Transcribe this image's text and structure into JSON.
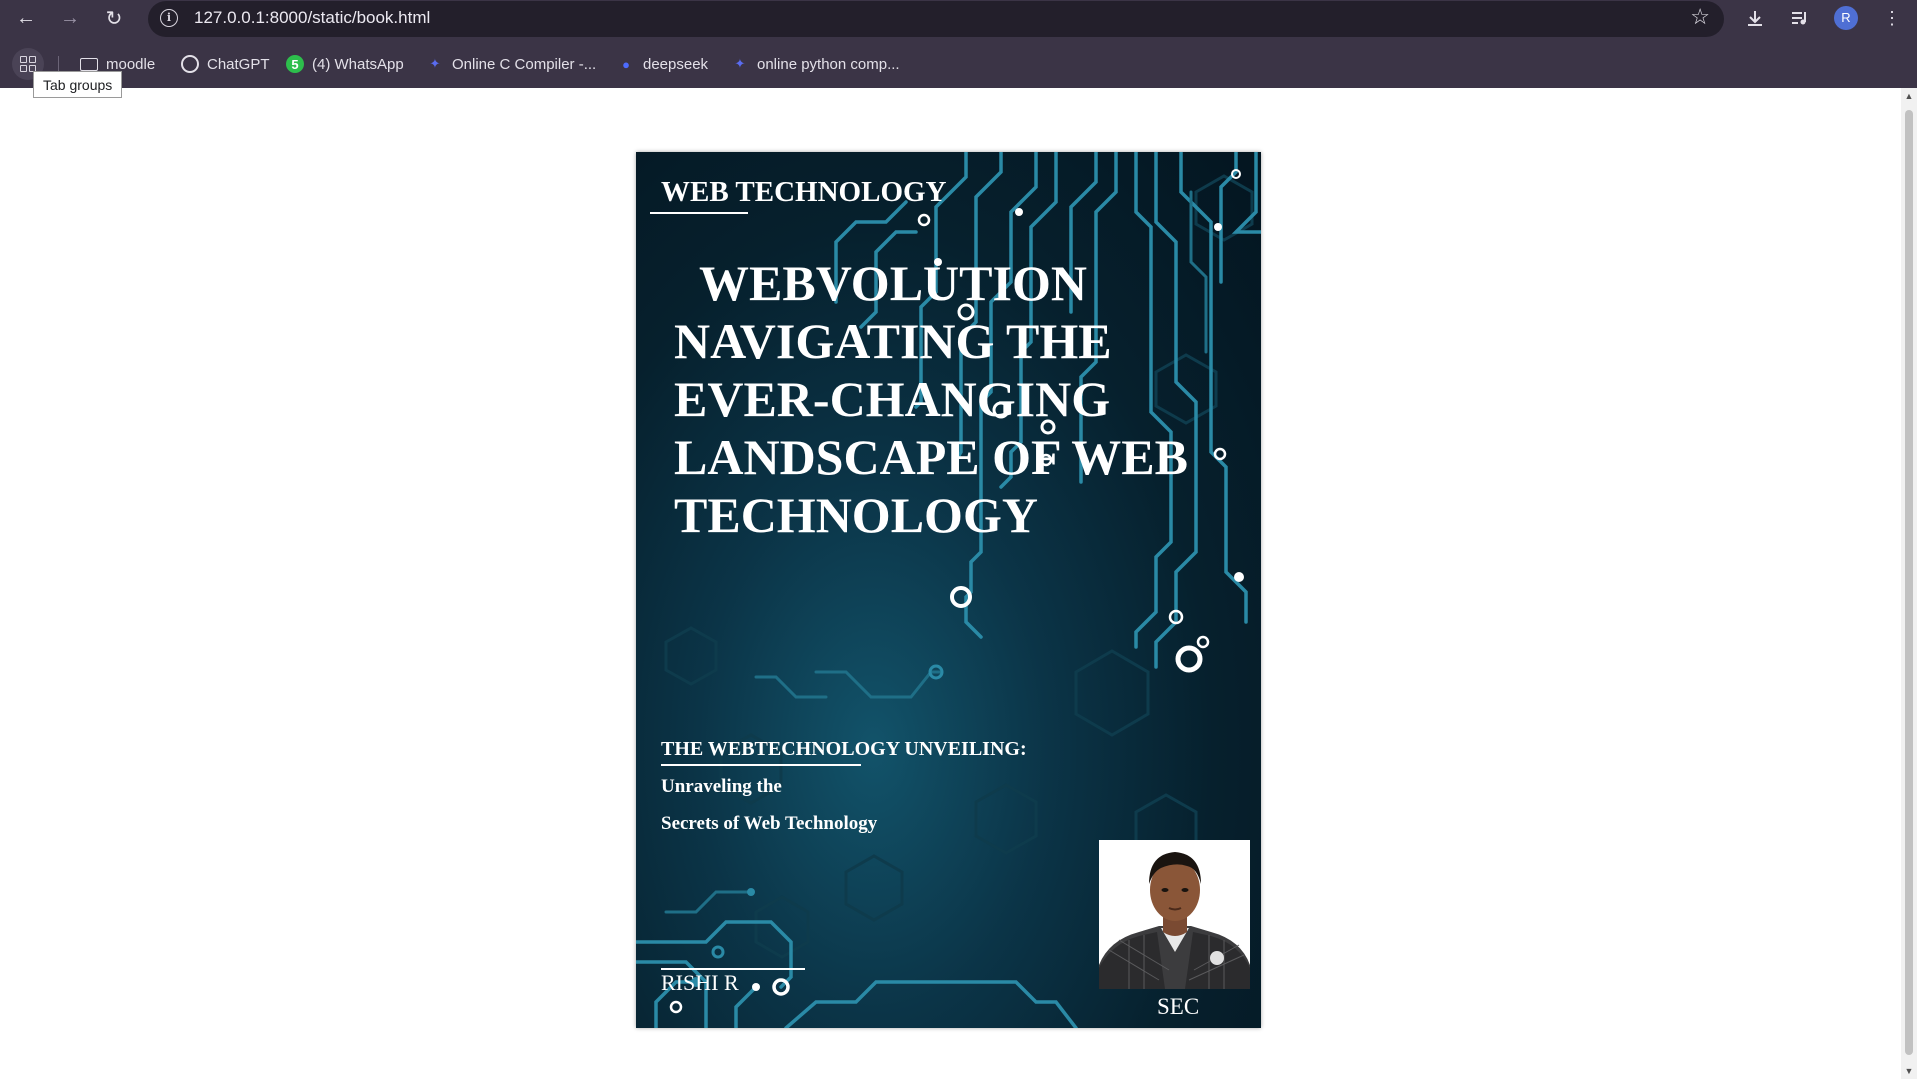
{
  "browser": {
    "url": "127.0.0.1:8000/static/book.html",
    "profile_initial": "R",
    "accent_color": "#3b3446"
  },
  "bookmarks": [
    {
      "label": "moodle",
      "icon": "folder-icon"
    },
    {
      "label": "ChatGPT",
      "icon": "chatgpt-icon"
    },
    {
      "label": "(4) WhatsApp",
      "icon": "whatsapp-icon",
      "badge": "5"
    },
    {
      "label": "Online C Compiler -...",
      "icon": "compiler-icon"
    },
    {
      "label": "deepseek",
      "icon": "deepseek-icon"
    },
    {
      "label": "online python comp...",
      "icon": "compiler-icon"
    }
  ],
  "tooltip": "Tab groups",
  "cover": {
    "series": "WEB TECHNOLOGY",
    "title_lines": [
      "WEBVOLUTION",
      "NAVIGATING THE",
      "EVER-CHANGING",
      "LANDSCAPE OF WEB",
      "TECHNOLOGY"
    ],
    "subtitle": "THE WEBTECHNOLOGY UNVEILING:",
    "subtitle_line2": "Unraveling the",
    "subtitle_line3": "Secrets of Web Technology",
    "author": "RISHI R",
    "institution": "SEC"
  }
}
